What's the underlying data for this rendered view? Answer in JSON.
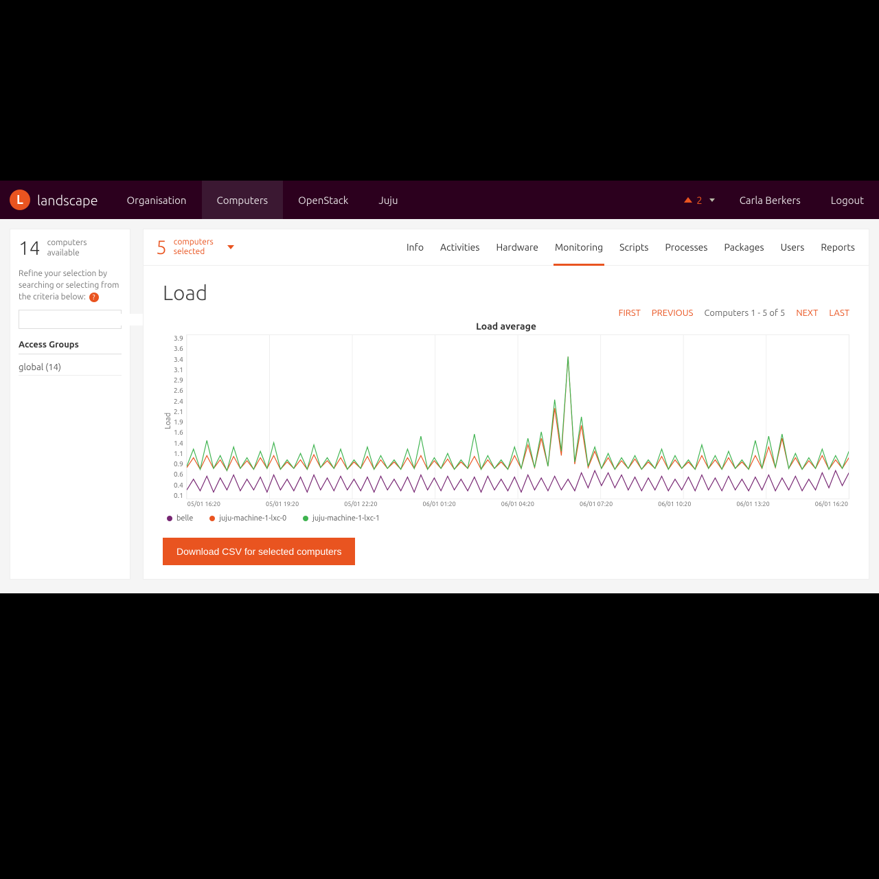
{
  "brand": {
    "letter": "L",
    "name": "landscape"
  },
  "nav": {
    "items": [
      {
        "label": "Organisation",
        "active": false
      },
      {
        "label": "Computers",
        "active": true
      },
      {
        "label": "OpenStack",
        "active": false
      },
      {
        "label": "Juju",
        "active": false
      }
    ],
    "alert_count": "2",
    "user": "Carla Berkers",
    "logout": "Logout"
  },
  "sidebar": {
    "available_count": "14",
    "available_label_line1": "computers",
    "available_label_line2": "available",
    "refine_text": "Refine your selection by searching or selecting from the criteria below:",
    "help_badge": "?",
    "search_placeholder": "",
    "access_heading": "Access Groups",
    "access_items": [
      "global (14)"
    ]
  },
  "main": {
    "selected_count": "5",
    "selected_label_line1": "computers",
    "selected_label_line2": "selected",
    "tabs": [
      "Info",
      "Activities",
      "Hardware",
      "Monitoring",
      "Scripts",
      "Processes",
      "Packages",
      "Users",
      "Reports"
    ],
    "active_tab": "Monitoring",
    "page_title": "Load",
    "pager": {
      "first": "FIRST",
      "previous": "PREVIOUS",
      "status": "Computers 1 - 5 of 5",
      "next": "NEXT",
      "last": "LAST"
    },
    "download_label": "Download CSV for selected computers"
  },
  "chart_data": {
    "type": "line",
    "title": "Load average",
    "ylabel": "Load",
    "xlabel": "",
    "ylim": [
      0.1,
      3.9
    ],
    "y_ticks": [
      "3.9",
      "3.6",
      "3.4",
      "3.1",
      "2.9",
      "2.6",
      "2.4",
      "2.1",
      "1.9",
      "1.6",
      "1.4",
      "1.1",
      "0.9",
      "0.6",
      "0.4",
      "0.1"
    ],
    "x_ticks": [
      "05/01 16:20",
      "05/01 19:20",
      "05/01 22:20",
      "06/01 01:20",
      "06/01 04:20",
      "06/01 07:20",
      "06/01 10:20",
      "06/01 13:20",
      "06/01 16:20"
    ],
    "series": [
      {
        "name": "belle",
        "color": "#762572",
        "values": [
          0.3,
          0.55,
          0.28,
          0.62,
          0.25,
          0.58,
          0.3,
          0.65,
          0.28,
          0.55,
          0.3,
          0.6,
          0.25,
          0.65,
          0.3,
          0.55,
          0.28,
          0.6,
          0.25,
          0.65,
          0.3,
          0.58,
          0.28,
          0.62,
          0.3,
          0.55,
          0.28,
          0.6,
          0.25,
          0.62,
          0.3,
          0.55,
          0.28,
          0.6,
          0.25,
          0.65,
          0.3,
          0.58,
          0.28,
          0.62,
          0.3,
          0.55,
          0.28,
          0.6,
          0.25,
          0.62,
          0.3,
          0.55,
          0.28,
          0.6,
          0.25,
          0.65,
          0.3,
          0.58,
          0.28,
          0.62,
          0.3,
          0.55,
          0.28,
          0.7,
          0.35,
          0.75,
          0.4,
          0.7,
          0.35,
          0.65,
          0.3,
          0.6,
          0.28,
          0.58,
          0.3,
          0.62,
          0.28,
          0.55,
          0.3,
          0.6,
          0.28,
          0.65,
          0.3,
          0.58,
          0.28,
          0.62,
          0.3,
          0.55,
          0.28,
          0.6,
          0.3,
          0.65,
          0.28,
          0.58,
          0.3,
          0.62,
          0.28,
          0.55,
          0.3,
          0.7,
          0.35,
          0.75,
          0.4,
          0.7
        ]
      },
      {
        "name": "juju-machine-1-lxc-0",
        "color": "#e95420",
        "values": [
          0.82,
          1.05,
          0.78,
          1.1,
          0.8,
          1.0,
          0.75,
          1.08,
          0.8,
          0.98,
          0.78,
          1.05,
          0.8,
          1.1,
          0.78,
          0.95,
          0.8,
          1.0,
          0.78,
          1.12,
          0.82,
          0.98,
          0.8,
          1.05,
          0.78,
          0.95,
          0.8,
          1.08,
          0.78,
          1.0,
          0.8,
          0.95,
          0.78,
          1.05,
          0.8,
          1.1,
          0.78,
          0.98,
          0.8,
          1.02,
          0.78,
          0.95,
          0.8,
          1.08,
          0.78,
          1.0,
          0.8,
          0.95,
          0.78,
          1.1,
          0.8,
          1.35,
          0.82,
          1.5,
          0.85,
          2.2,
          1.1,
          3.4,
          0.9,
          1.8,
          0.82,
          1.2,
          0.8,
          1.05,
          0.78,
          0.98,
          0.8,
          1.02,
          0.78,
          0.95,
          0.8,
          1.08,
          0.78,
          1.0,
          0.8,
          0.95,
          0.78,
          1.1,
          0.8,
          1.0,
          0.78,
          1.05,
          0.8,
          0.95,
          0.78,
          1.1,
          0.8,
          1.3,
          0.82,
          1.5,
          0.8,
          1.05,
          0.78,
          0.98,
          0.8,
          1.1,
          0.78,
          1.0,
          0.8,
          1.05
        ]
      },
      {
        "name": "juju-machine-1-lxc-1",
        "color": "#3eb34f",
        "values": [
          0.85,
          1.25,
          0.78,
          1.45,
          0.8,
          1.1,
          0.75,
          1.3,
          0.8,
          1.05,
          0.78,
          1.2,
          0.8,
          1.4,
          0.78,
          1.0,
          0.8,
          1.15,
          0.78,
          1.35,
          0.82,
          1.05,
          0.8,
          1.25,
          0.78,
          1.0,
          0.8,
          1.3,
          0.78,
          1.1,
          0.8,
          1.0,
          0.78,
          1.25,
          0.8,
          1.55,
          0.78,
          1.05,
          0.8,
          1.15,
          0.78,
          1.0,
          0.8,
          1.6,
          0.78,
          1.1,
          0.8,
          1.0,
          0.78,
          1.3,
          0.8,
          1.5,
          0.82,
          1.65,
          0.85,
          2.4,
          1.2,
          3.4,
          0.95,
          2.0,
          0.85,
          1.3,
          0.8,
          1.15,
          0.78,
          1.05,
          0.8,
          1.1,
          0.78,
          1.0,
          0.8,
          1.25,
          0.78,
          1.1,
          0.8,
          1.0,
          0.78,
          1.35,
          0.8,
          1.1,
          0.78,
          1.2,
          0.8,
          1.0,
          0.78,
          1.45,
          0.8,
          1.55,
          0.82,
          1.6,
          0.8,
          1.15,
          0.78,
          1.05,
          0.8,
          1.25,
          0.78,
          1.1,
          0.8,
          1.2
        ]
      }
    ]
  }
}
